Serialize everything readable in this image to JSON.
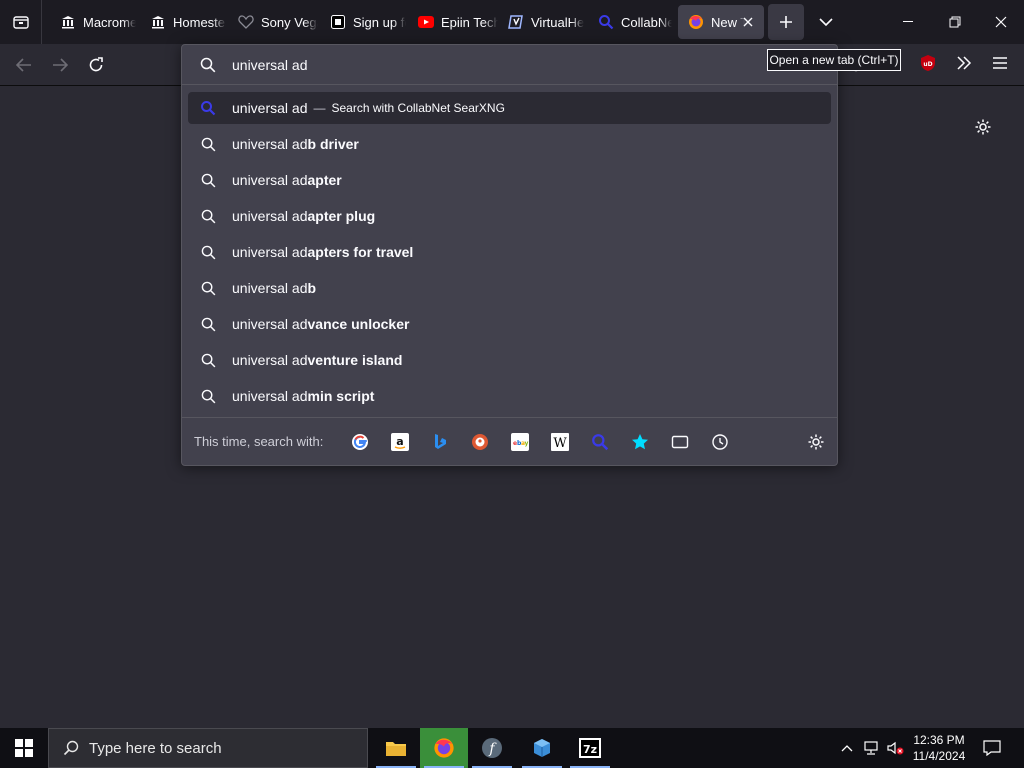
{
  "tabs": [
    {
      "label": "Macromedia",
      "icon": "museum-icon"
    },
    {
      "label": "Homestead",
      "icon": "museum-icon"
    },
    {
      "label": "Sony Vegas",
      "icon": "heart-icon"
    },
    {
      "label": "Sign up for",
      "icon": "app-icon"
    },
    {
      "label": "Epiin Tech",
      "icon": "youtube-icon"
    },
    {
      "label": "VirtualHere",
      "icon": "virtualhere-icon"
    },
    {
      "label": "CollabNet",
      "icon": "searxng-icon"
    },
    {
      "label": "New Tab",
      "icon": "firefox-icon"
    }
  ],
  "urlbar": {
    "value": "universal ad",
    "typed": "universal ad",
    "selected_action": "Search with CollabNet SearXNG",
    "action_separator": "—",
    "suggestions": [
      {
        "typed": "universal ad",
        "rest": "b driver"
      },
      {
        "typed": "universal ad",
        "rest": "apter"
      },
      {
        "typed": "universal ad",
        "rest": "apter plug"
      },
      {
        "typed": "universal ad",
        "rest": "apters for travel"
      },
      {
        "typed": "universal ad",
        "rest": "b"
      },
      {
        "typed": "universal ad",
        "rest": "vance unlocker"
      },
      {
        "typed": "universal ad",
        "rest": "venture island"
      },
      {
        "typed": "universal ad",
        "rest": "min script"
      }
    ],
    "oneoff_label": "This time, search with:",
    "engines": [
      "google",
      "amazon",
      "bing",
      "duckduckgo",
      "ebay",
      "wikipedia",
      "searxng",
      "bookmarks",
      "tabs",
      "history"
    ]
  },
  "tooltip": "Open a new tab (Ctrl+T)",
  "taskbar": {
    "search_placeholder": "Type here to search",
    "time": "12:36 PM",
    "date": "11/4/2024"
  },
  "colors": {
    "accent": "#3a3ae8",
    "panel": "#42414d",
    "toolbar": "#2b2a33",
    "tabbar": "#1c1b22"
  }
}
